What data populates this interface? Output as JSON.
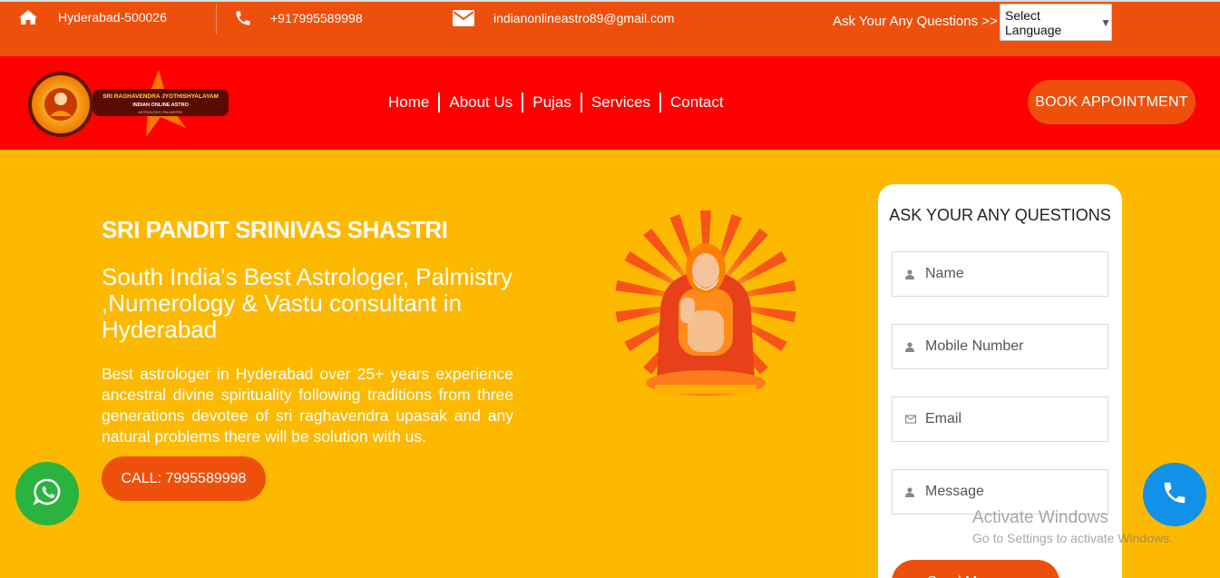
{
  "topbar": {
    "address": "Hyderabad-500026",
    "phone": "+917995589998",
    "email": "indianonlineastro89@gmail.com",
    "ask": "Ask Your Any Questions >>",
    "language": "Select Language",
    "icons": [
      "home-icon",
      "phone-icon",
      "envelope-icon"
    ]
  },
  "logo": {
    "line1": "SRI RAGHAVENDRA JYOTHISHYALAYAM",
    "line2": "INDIAN ONLINE ASTRO",
    "line3": "ASTROLOGY, PALMISTRY"
  },
  "nav": {
    "items": [
      "Home",
      "About Us",
      "Pujas",
      "Services",
      "Contact"
    ],
    "book": "BOOK APPOINTMENT"
  },
  "hero": {
    "name": "SRI PANDIT SRINIVAS SHASTRI",
    "subtitle": "South India's Best Astrologer, Palmistry ,Numerology & Vastu consultant in Hyderabad",
    "description": "Best astrologer in Hyderabad over 25+ years experience ancestral divine spirituality following traditions from three generations devotee of sri raghavendra upasak and any natural problems there will be solution with us.",
    "call": "CALL: 7995589998"
  },
  "form": {
    "title": "ASK YOUR ANY QUESTIONS",
    "name_placeholder": "Name",
    "mobile_placeholder": "Mobile Number",
    "email_placeholder": "Email",
    "message_placeholder": "Message",
    "submit": "Send Message"
  },
  "watermark": {
    "line1": "Activate Windows",
    "line2": "Go to Settings to activate Windows."
  },
  "colors": {
    "topbar": "#ee500c",
    "navbar": "#ff0000",
    "hero": "#fdb900",
    "button": "#ee500c",
    "whatsapp": "#2bb33f",
    "call": "#1291e8"
  }
}
